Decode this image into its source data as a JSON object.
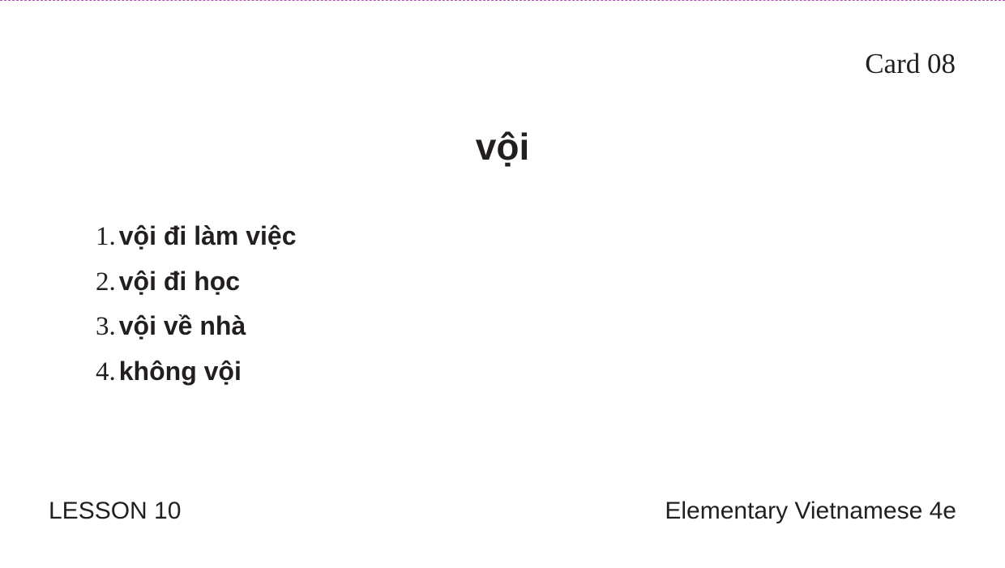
{
  "card": {
    "number": "Card 08",
    "headword": "vội",
    "phrases": [
      {
        "num": "1.",
        "text": "vội đi làm việc"
      },
      {
        "num": "2.",
        "text": "vội đi học"
      },
      {
        "num": "3.",
        "text": "vội về nhà"
      },
      {
        "num": "4.",
        "text": "không vội"
      }
    ]
  },
  "footer": {
    "lesson": "LESSON 10",
    "book": "Elementary Vietnamese 4e"
  },
  "colors": {
    "text": "#231f20",
    "cut_line": "#b04fb0",
    "background": "#ffffff"
  }
}
